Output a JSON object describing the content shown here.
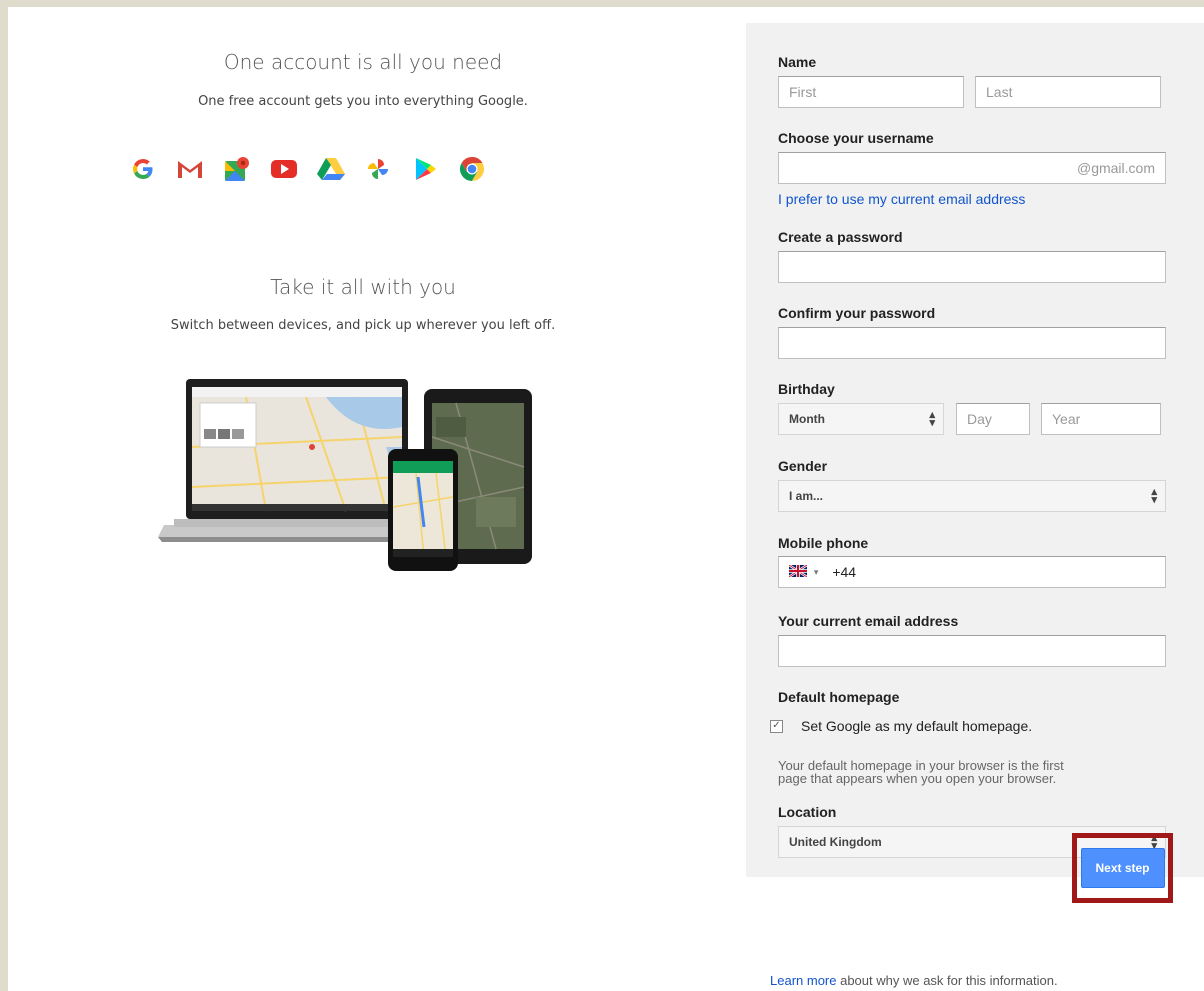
{
  "left": {
    "headline1": "One account is all you need",
    "subline1": "One free account gets you into everything Google.",
    "icons": [
      "google-g-icon",
      "gmail-icon",
      "maps-icon",
      "youtube-icon",
      "drive-icon",
      "photos-icon",
      "play-icon",
      "chrome-icon"
    ],
    "headline2": "Take it all with you",
    "subline2": "Switch between devices, and pick up wherever you left off."
  },
  "form": {
    "name_label": "Name",
    "first_placeholder": "First",
    "last_placeholder": "Last",
    "username_label": "Choose your username",
    "username_suffix": "@gmail.com",
    "prefer_link": "I prefer to use my current email address",
    "password_label": "Create a password",
    "confirm_label": "Confirm your password",
    "birthday_label": "Birthday",
    "month_value": "Month",
    "day_placeholder": "Day",
    "year_placeholder": "Year",
    "gender_label": "Gender",
    "gender_value": "I am...",
    "phone_label": "Mobile phone",
    "phone_code": "+44",
    "email_label": "Your current email address",
    "homepage_label": "Default homepage",
    "homepage_checkbox": "Set Google as my default homepage.",
    "homepage_hint_line1": "Your default homepage in your browser is the first",
    "homepage_hint_line2": "page that appears when you open your browser.",
    "location_label": "Location",
    "location_value": "United Kingdom",
    "next_button": "Next step"
  },
  "footer": {
    "learn_more": "Learn more",
    "rest": " about why we ask for this information."
  },
  "colors": {
    "link": "#1155cc",
    "button": "#4d90fe",
    "highlight_border": "#a01818",
    "panel_bg": "#f1f1f1"
  }
}
